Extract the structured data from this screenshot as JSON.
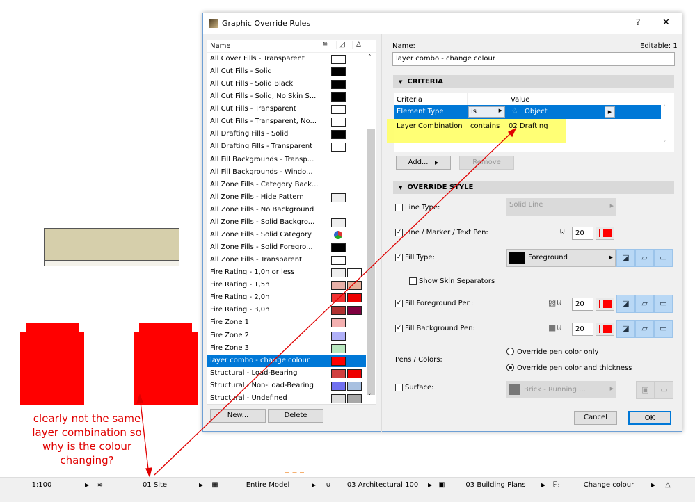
{
  "dialog": {
    "title": "Graphic Override Rules",
    "help": "?",
    "close": "✕"
  },
  "list": {
    "header": "Name",
    "items": [
      {
        "name": "All Cover Fills - Transparent",
        "s1": "#ffffff"
      },
      {
        "name": "All Cut Fills - Solid",
        "s1": "#000000"
      },
      {
        "name": "All Cut Fills - Solid Black",
        "s1": "#000000"
      },
      {
        "name": "All Cut Fills - Solid, No Skin S...",
        "s1": "#000000"
      },
      {
        "name": "All Cut Fills - Transparent",
        "s1": "#ffffff"
      },
      {
        "name": "All Cut Fills - Transparent, No...",
        "s1": "#ffffff"
      },
      {
        "name": "All Drafting Fills - Solid",
        "s1": "#000000"
      },
      {
        "name": "All Drafting Fills - Transparent",
        "s1": "#ffffff"
      },
      {
        "name": "All Fill Backgrounds - Transp..."
      },
      {
        "name": "All Fill Backgrounds - Windo..."
      },
      {
        "name": "All Zone Fills - Category Back..."
      },
      {
        "name": "All Zone Fills - Hide Pattern",
        "s1": "#eeeeee"
      },
      {
        "name": "All Zone Fills - No Background"
      },
      {
        "name": "All Zone Fills - Solid Backgro...",
        "s1": "#eeeeee"
      },
      {
        "name": "All Zone Fills - Solid Category",
        "icon": "category-color-icon"
      },
      {
        "name": "All Zone Fills - Solid Foregro...",
        "s1": "#000000"
      },
      {
        "name": "All Zone Fills - Transparent",
        "s1": "#ffffff"
      },
      {
        "name": "Fire Rating - 1,0h or less",
        "s1": "#eeeeee",
        "s2": "#ffffff"
      },
      {
        "name": "Fire Rating - 1,5h",
        "s1": "#e8b0a8",
        "s2": "#e8b09a"
      },
      {
        "name": "Fire Rating - 2,0h",
        "s1": "#f03030",
        "s2": "#ee0000"
      },
      {
        "name": "Fire Rating - 3,0h",
        "s1": "#b03030",
        "s2": "#800040"
      },
      {
        "name": "Fire Zone 1",
        "s1": "#f4b0b0"
      },
      {
        "name": "Fire Zone 2",
        "s1": "#b0b0f8"
      },
      {
        "name": "Fire Zone 3",
        "s1": "#b8e8c0"
      },
      {
        "name": "layer combo - change colour",
        "s1": "#ff0000",
        "selected": true
      },
      {
        "name": "Structural - Load-Bearing",
        "s1": "#d04040",
        "s2": "#ee0000"
      },
      {
        "name": "Structural - Non-Load-Bearing",
        "s1": "#7070f0",
        "s2": "#a8c0e0"
      },
      {
        "name": "Structural - Undefined",
        "s1": "#dddddd",
        "s2": "#a8a8a8"
      }
    ],
    "new": "New...",
    "delete": "Delete"
  },
  "right": {
    "name_label": "Name:",
    "editable": "Editable: 1",
    "name_value": "layer combo - change colour",
    "criteria": {
      "title": "CRITERIA",
      "col1": "Criteria",
      "col3": "Value",
      "rows": [
        {
          "c": "Element Type",
          "op": "is",
          "v": "Object"
        },
        {
          "c": "Layer Combination",
          "op": "contains",
          "v": "02 Drafting"
        }
      ],
      "add": "Add...",
      "remove": "Remove"
    },
    "override": {
      "title": "OVERRIDE STYLE",
      "line_type": "Line Type:",
      "line_type_value": "Solid Line",
      "line_pen": "Line / Marker / Text Pen:",
      "pen_value": "20",
      "fill_type": "Fill Type:",
      "fill_value": "Foreground",
      "skin": "Show Skin Separators",
      "fg_pen": "Fill Foreground Pen:",
      "bg_pen": "Fill Background Pen:",
      "pens_colors": "Pens / Colors:",
      "radio1": "Override pen color only",
      "radio2": "Override pen color and thickness",
      "surface": "Surface:",
      "surface_value": "Brick - Running ..."
    },
    "cancel": "Cancel",
    "ok": "OK"
  },
  "annotation": [
    "clearly not the same",
    "layer combination so",
    "why is the colour",
    "changing?"
  ],
  "status": {
    "scale": "1:100",
    "layer": "01 Site",
    "model": "Entire Model",
    "pen_set": "03 Architectural 100",
    "view": "03 Building Plans",
    "override": "Change colour"
  },
  "colors": {
    "accent": "#0078d7",
    "highlight": "#ffff66",
    "annotation": "#e00000",
    "canvas_fill": "#d6cfab",
    "element": "#ff0000"
  }
}
